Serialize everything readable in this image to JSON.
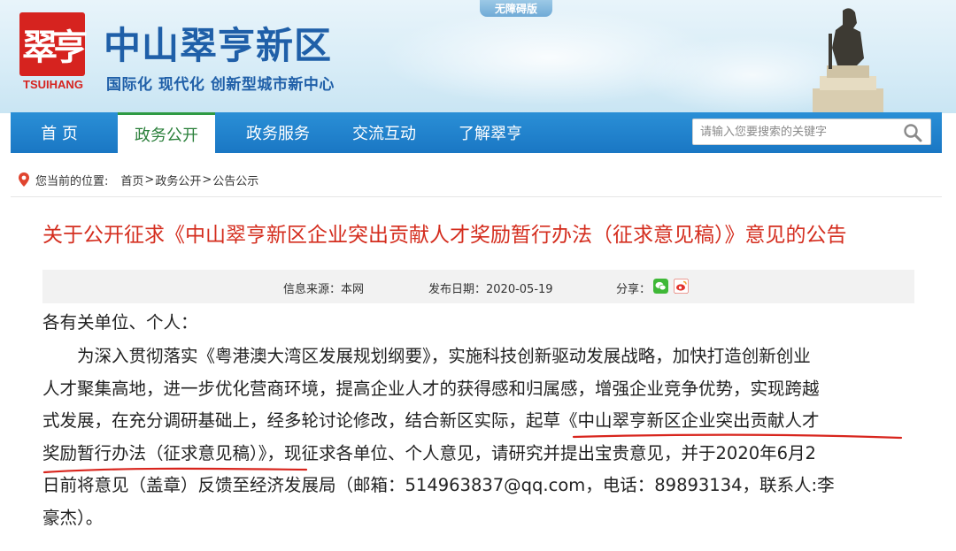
{
  "header": {
    "logo_mark": "翠亨",
    "logo_en": "TSUIHANG",
    "site_title": "中山翠亨新区",
    "slogan": "国际化  现代化  创新型城市新中心",
    "accessible_label": "无障碍版"
  },
  "nav": {
    "items": [
      {
        "label": "首 页"
      },
      {
        "label": "政务公开"
      },
      {
        "label": "政务服务"
      },
      {
        "label": "交流互动"
      },
      {
        "label": "了解翠亨"
      }
    ],
    "active_index": 1,
    "search_placeholder": "请输入您要搜索的关键字"
  },
  "breadcrumb": {
    "prefix": "您当前的位置:",
    "items": [
      "首页",
      ">",
      "政务公开",
      " >",
      "公告公示"
    ]
  },
  "article": {
    "title": "关于公开征求《中山翠亨新区企业突出贡献人才奖励暂行办法（征求意见稿）》意见的公告",
    "source_label": "信息来源：本网",
    "date_label": "发布日期：2020-05-19",
    "share_label": "分享：",
    "salutation": "各有关单位、个人：",
    "lines": [
      "　　为深入贯彻落实《粤港澳大湾区发展规划纲要》，实施科技创新驱动发展战略，加快打造创新创业",
      "人才聚集高地，进一步优化营商环境，提高企业人才的获得感和归属感，增强企业竞争优势，实现跨越",
      "式发展，在充分调研基础上，经多轮讨论修改，结合新区实际，",
      "起草《中山翠亨新区企业突出贡献人才",
      "奖励暂行办法（征求意见稿）》",
      "，现征求各单位、个人意见，请研究并提出宝贵意见，并于2020年6月2",
      "日前将意见（盖章）反馈至经济发展局（邮箱：514963837@qq.com，电话：89893134，联系人:李",
      "豪杰）。"
    ]
  },
  "colors": {
    "nav_blue": "#1f82cf",
    "title_red": "#d42d1e",
    "brand_blue": "#1f5fa8",
    "logo_red": "#d6231f",
    "active_green": "#2a7f3a"
  }
}
